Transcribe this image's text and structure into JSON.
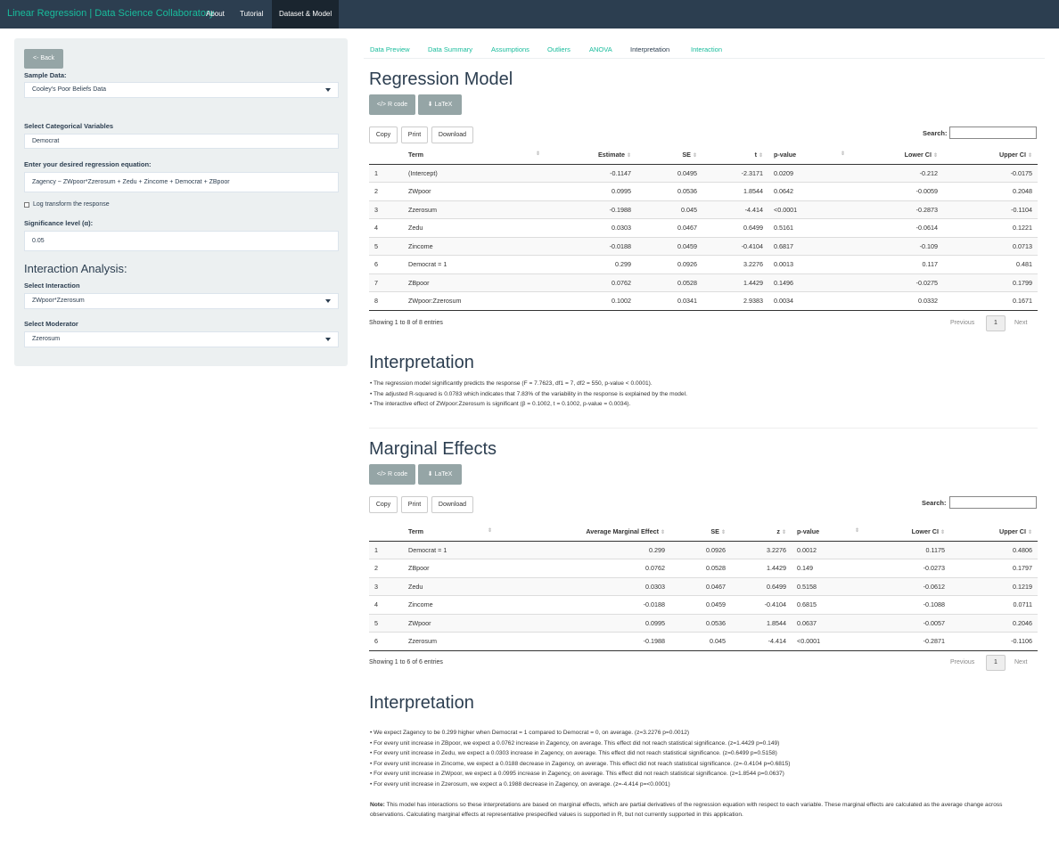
{
  "navbar": {
    "brand": "Linear Regression | Data Science Collaboratory",
    "items": [
      "About",
      "Tutorial",
      "Dataset & Model"
    ]
  },
  "sidebar": {
    "back_label": "<- Back",
    "sample_data_label": "Sample Data:",
    "sample_data_value": "Cooley's Poor Beliefs Data",
    "categorical_label": "Select Categorical Variables",
    "categorical_value": "Democrat",
    "equation_label": "Enter your desired regression equation:",
    "equation_value": "Zagency ~ ZWpoor*Zzerosum + Zedu + Zincome + Democrat + ZBpoor",
    "log_label": "Log transform the response",
    "log_checked": false,
    "significance_label": "Significance level (α):",
    "significance_value": "0.05",
    "interaction_title": "Interaction Analysis:",
    "interaction_label": "Select Interaction",
    "interaction_value": "ZWpoor*Zzerosum",
    "moderator_label": "Select Moderator",
    "moderator_value": "Zzerosum"
  },
  "tabs": [
    "Data Preview",
    "Data Summary",
    "Assumptions",
    "Outliers",
    "ANOVA",
    "Interpretation",
    "Interaction"
  ],
  "active_tab": "Interpretation",
  "regression": {
    "title": "Regression Model",
    "rcode_label": "R code",
    "latex_label": "LaTeX",
    "copy_label": "Copy",
    "print_label": "Print",
    "download_label": "Download",
    "search_label": "Search:",
    "columns": [
      "",
      "Term",
      "Estimate",
      "SE",
      "t",
      "p-value",
      "Lower CI",
      "Upper CI"
    ],
    "rows": [
      [
        "1",
        "(Intercept)",
        "-0.1147",
        "0.0495",
        "-2.3171",
        "0.0209",
        "-0.212",
        "-0.0175"
      ],
      [
        "2",
        "ZWpoor",
        "0.0995",
        "0.0536",
        "1.8544",
        "0.0642",
        "-0.0059",
        "0.2048"
      ],
      [
        "3",
        "Zzerosum",
        "-0.1988",
        "0.045",
        "-4.414",
        "<0.0001",
        "-0.2873",
        "-0.1104"
      ],
      [
        "4",
        "Zedu",
        "0.0303",
        "0.0467",
        "0.6499",
        "0.5161",
        "-0.0614",
        "0.1221"
      ],
      [
        "5",
        "Zincome",
        "-0.0188",
        "0.0459",
        "-0.4104",
        "0.6817",
        "-0.109",
        "0.0713"
      ],
      [
        "6",
        "Democrat = 1",
        "0.299",
        "0.0926",
        "3.2276",
        "0.0013",
        "0.117",
        "0.481"
      ],
      [
        "7",
        "ZBpoor",
        "0.0762",
        "0.0528",
        "1.4429",
        "0.1496",
        "-0.0275",
        "0.1799"
      ],
      [
        "8",
        "ZWpoor:Zzerosum",
        "0.1002",
        "0.0341",
        "2.9383",
        "0.0034",
        "0.0332",
        "0.1671"
      ]
    ],
    "info": "Showing 1 to 8 of 8 entries",
    "previous_label": "Previous",
    "page": "1",
    "next_label": "Next"
  },
  "interpretation1": {
    "title": "Interpretation",
    "bullets": [
      "• The regression model significantly predicts the response (F = 7.7623, df1 = 7, df2 = 550, p-value < 0.0001).",
      "• The adjusted R-squared is 0.0783 which indicates that 7.83% of the variability in the response is explained by the model.",
      "• The interactive effect of ZWpoor:Zzerosum is significant (β = 0.1002, t = 0.1002, p-value = 0.0034)."
    ]
  },
  "marginal": {
    "title": "Marginal Effects",
    "rcode_label": "R code",
    "latex_label": "LaTeX",
    "copy_label": "Copy",
    "print_label": "Print",
    "download_label": "Download",
    "search_label": "Search:",
    "columns": [
      "",
      "Term",
      "Average Marginal Effect",
      "SE",
      "z",
      "p-value",
      "Lower CI",
      "Upper CI"
    ],
    "rows": [
      [
        "1",
        "Democrat = 1",
        "0.299",
        "0.0926",
        "3.2276",
        "0.0012",
        "0.1175",
        "0.4806"
      ],
      [
        "2",
        "ZBpoor",
        "0.0762",
        "0.0528",
        "1.4429",
        "0.149",
        "-0.0273",
        "0.1797"
      ],
      [
        "3",
        "Zedu",
        "0.0303",
        "0.0467",
        "0.6499",
        "0.5158",
        "-0.0612",
        "0.1219"
      ],
      [
        "4",
        "Zincome",
        "-0.0188",
        "0.0459",
        "-0.4104",
        "0.6815",
        "-0.1088",
        "0.0711"
      ],
      [
        "5",
        "ZWpoor",
        "0.0995",
        "0.0536",
        "1.8544",
        "0.0637",
        "-0.0057",
        "0.2046"
      ],
      [
        "6",
        "Zzerosum",
        "-0.1988",
        "0.045",
        "-4.414",
        "<0.0001",
        "-0.2871",
        "-0.1106"
      ]
    ],
    "info": "Showing 1 to 6 of 6 entries",
    "previous_label": "Previous",
    "page": "1",
    "next_label": "Next"
  },
  "interpretation2": {
    "title": "Interpretation",
    "bullets": [
      "• We expect Zagency to be 0.299 higher when Democrat = 1 compared to Democrat = 0, on average. (z=3.2276 p=0.0012)",
      "• For every unit increase in ZBpoor, we expect a 0.0762 increase in Zagency, on average. This effect did not reach statistical significance. (z=1.4429 p=0.149)",
      "• For every unit increase in Zedu, we expect a 0.0303 increase in Zagency, on average. This effect did not reach statistical significance. (z=0.6499 p=0.5158)",
      "• For every unit increase in Zincome, we expect a 0.0188 decrease in Zagency, on average. This effect did not reach statistical significance. (z=-0.4104 p=0.6815)",
      "• For every unit increase in ZWpoor, we expect a 0.0995 increase in Zagency, on average. This effect did not reach statistical significance. (z=1.8544 p=0.0637)",
      "• For every unit increase in Zzerosum, we expect a 0.1988 decrease in Zagency, on average. (z=-4.414 p=<0.0001)"
    ],
    "note_label": "Note:",
    "note_text": " This model has interactions so these interpretations are based on marginal effects, which are partial derivatives of the regression equation with respect to each variable. These marginal effects are calculated as the average change across observations. Calculating marginal effects at representative prespecified values is supported in R, but not currently supported in this application."
  },
  "colors": {
    "navbar": "#2c3e50",
    "accent": "#18bc9c",
    "sidebar": "#ecf0f1",
    "button_grey": "#95a5a6"
  },
  "icons": {
    "rcode": "code-icon",
    "latex": "download-icon",
    "dropdown": "caret-down-icon",
    "sort": "sort-icon"
  }
}
